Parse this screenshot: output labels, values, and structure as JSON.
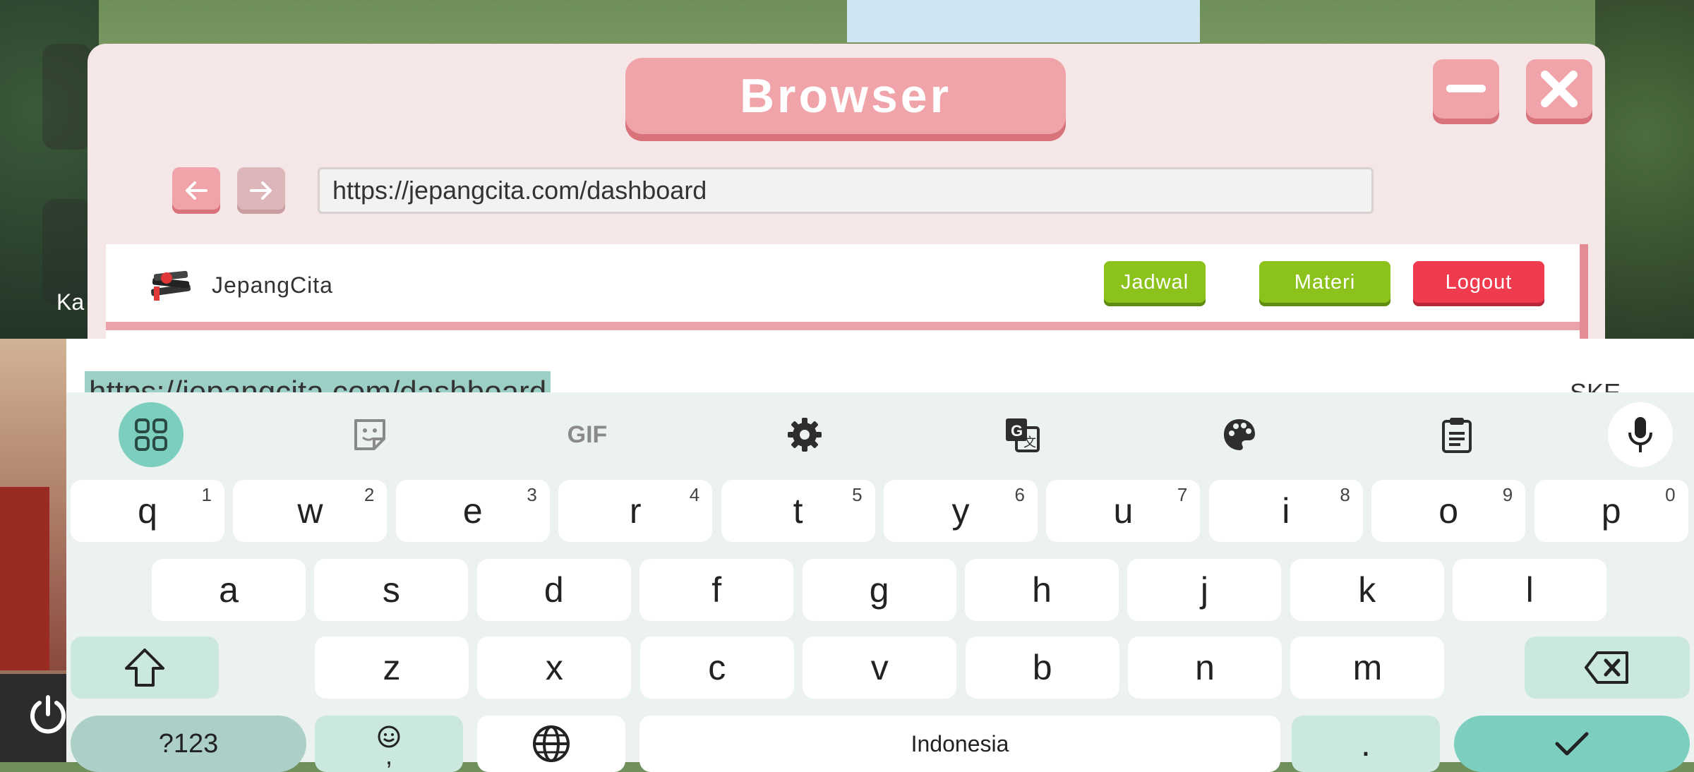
{
  "window": {
    "title": "Browser",
    "url": "https://jepangcita.com/dashboard"
  },
  "site": {
    "brand": "JepangCita",
    "nav": [
      {
        "label": "Jadwal",
        "color": "#8cc21c",
        "shadow": "#5f8c0e"
      },
      {
        "label": "Materi",
        "color": "#8cc21c",
        "shadow": "#5f8c0e"
      },
      {
        "label": "Logout",
        "color": "#f03a4e",
        "shadow": "#b8263a"
      }
    ]
  },
  "desktop": {
    "partial_label": "Ka"
  },
  "keyboard": {
    "suggestion": "https://jepangcita.com/dashboard",
    "suggestion_right": "SKE",
    "toolbar": [
      "apps-icon",
      "sticker-icon",
      "gif-icon",
      "settings-icon",
      "translate-icon",
      "palette-icon",
      "clipboard-icon",
      "mic-icon"
    ],
    "gif_label": "GIF",
    "row1": [
      {
        "k": "q",
        "n": "1"
      },
      {
        "k": "w",
        "n": "2"
      },
      {
        "k": "e",
        "n": "3"
      },
      {
        "k": "r",
        "n": "4"
      },
      {
        "k": "t",
        "n": "5"
      },
      {
        "k": "y",
        "n": "6"
      },
      {
        "k": "u",
        "n": "7"
      },
      {
        "k": "i",
        "n": "8"
      },
      {
        "k": "o",
        "n": "9"
      },
      {
        "k": "p",
        "n": "0"
      }
    ],
    "row2": [
      "a",
      "s",
      "d",
      "f",
      "g",
      "h",
      "j",
      "k",
      "l"
    ],
    "row3": [
      "z",
      "x",
      "c",
      "v",
      "b",
      "n",
      "m"
    ],
    "symbols_label": "?123",
    "emoji_comma": ",",
    "space_label": "Indonesia",
    "period": "."
  },
  "colors": {
    "accent": "#f0a3a8",
    "keyboard_bg": "#ecf2ef",
    "enter_key": "#7ccfbf"
  }
}
